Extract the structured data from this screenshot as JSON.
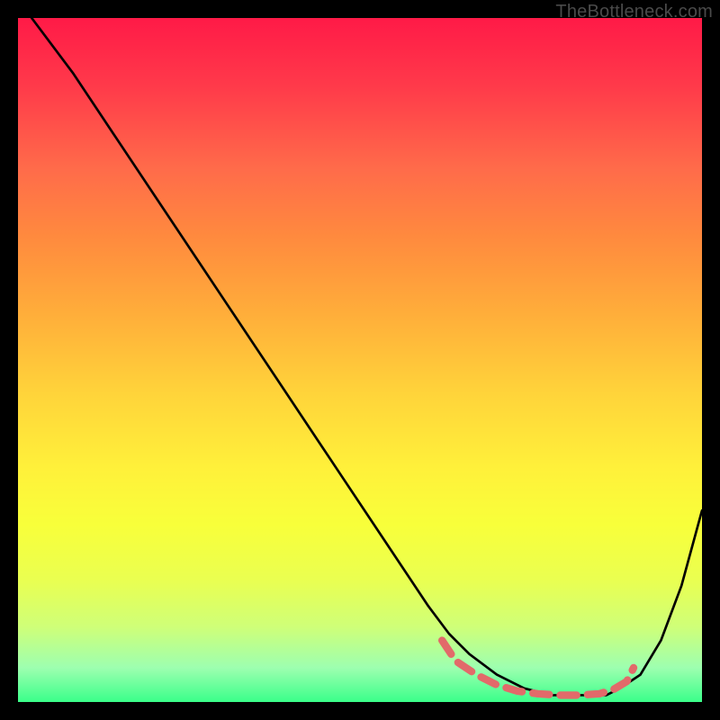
{
  "watermark": "TheBottleneck.com",
  "chart_data": {
    "type": "line",
    "title": "",
    "xlabel": "",
    "ylabel": "",
    "xlim": [
      0,
      100
    ],
    "ylim": [
      0,
      100
    ],
    "grid": false,
    "background_gradient": {
      "top": "#ff1a47",
      "middle": "#fff13a",
      "bottom": "#3aff8a"
    },
    "series": [
      {
        "name": "bottleneck-curve",
        "color": "#000000",
        "x": [
          2,
          8,
          14,
          20,
          26,
          32,
          38,
          44,
          50,
          56,
          60,
          63,
          66,
          70,
          74,
          78,
          82,
          86,
          88,
          91,
          94,
          97,
          100
        ],
        "y": [
          100,
          92,
          83,
          74,
          65,
          56,
          47,
          38,
          29,
          20,
          14,
          10,
          7,
          4,
          2,
          1,
          1,
          1,
          2,
          4,
          9,
          17,
          28
        ]
      },
      {
        "name": "bottleneck-highlight-dashed",
        "color": "#e26a6a",
        "dashed": true,
        "x": [
          62,
          64,
          67,
          70,
          73,
          76,
          79,
          82,
          85,
          87,
          89,
          90
        ],
        "y": [
          9,
          6,
          4,
          2.5,
          1.6,
          1.2,
          1,
          1,
          1.2,
          1.8,
          3,
          5
        ]
      }
    ]
  }
}
